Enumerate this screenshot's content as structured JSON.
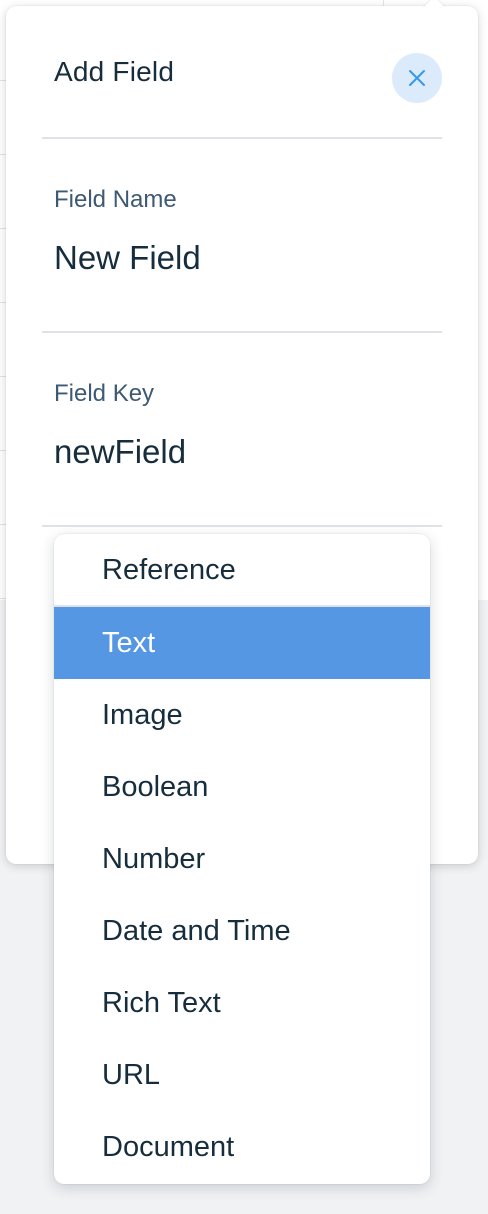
{
  "popover": {
    "title": "Add Field",
    "close_icon": "close-icon",
    "fields": [
      {
        "label": "Field Name",
        "value": "New Field"
      },
      {
        "label": "Field Key",
        "value": "newField"
      }
    ]
  },
  "type_dropdown": {
    "selected": "Text",
    "options": [
      "Reference",
      "Text",
      "Image",
      "Boolean",
      "Number",
      "Date and Time",
      "Rich Text",
      "URL",
      "Document"
    ]
  },
  "colors": {
    "selected_bg": "#5597e3",
    "close_bg": "#dcebfb",
    "text": "#162d3d",
    "label": "#3e5a73"
  }
}
